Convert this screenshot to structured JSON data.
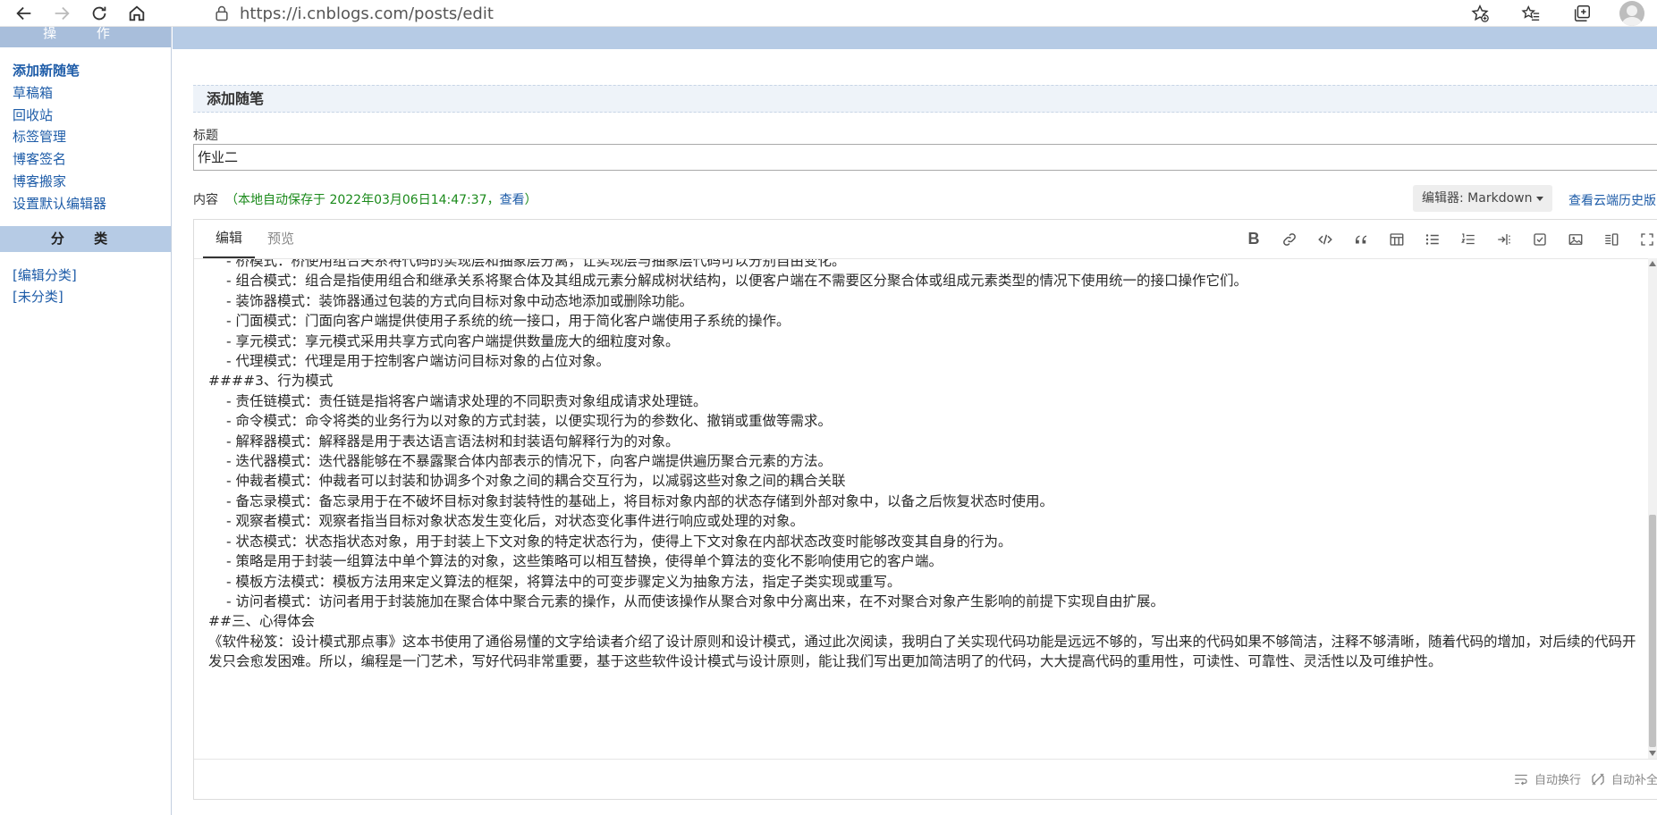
{
  "browser": {
    "url": "https://i.cnblogs.com/posts/edit"
  },
  "sidebar": {
    "header": "操 作",
    "links": [
      {
        "label": "添加新随笔"
      },
      {
        "label": "草稿箱"
      },
      {
        "label": "回收站"
      },
      {
        "label": "标签管理"
      },
      {
        "label": "博客签名"
      },
      {
        "label": "博客搬家"
      },
      {
        "label": "设置默认编辑器"
      }
    ],
    "category_header": "分 类",
    "category_links": [
      {
        "label": "[编辑分类]"
      },
      {
        "label": "[未分类]"
      }
    ]
  },
  "main": {
    "section_title": "添加随笔",
    "title_label": "标题",
    "title_value": "作业二",
    "content_label": "内容",
    "autosave_note": "（本地自动保存于 2022年03月06日14:47:37，",
    "autosave_view": "查看",
    "autosave_close": "）",
    "editor_select": "编辑器: Markdown",
    "cloud_history": "查看云端历史版"
  },
  "editor": {
    "tabs": [
      {
        "label": "编辑"
      },
      {
        "label": "预览"
      }
    ],
    "toolbar_icons": [
      "bold-icon",
      "link-icon",
      "code-icon",
      "quote-icon",
      "table-icon",
      "unordered-list-icon",
      "ordered-list-icon",
      "indent-icon",
      "task-icon",
      "image-icon",
      "split-view-icon",
      "fullscreen-icon"
    ],
    "lines": [
      "-  桥模式：桥使用组合关系将代码的实现层和抽象层分离，让实现层与抽象层代码可以分别自由变化。",
      "-  组合模式：组合是指使用组合和继承关系将聚合体及其组成元素分解成树状结构，以便客户端在不需要区分聚合体或组成元素类型的情况下使用统一的接口操作它们。",
      "-  装饰器模式：装饰器通过包装的方式向目标对象中动态地添加或删除功能。",
      "-  门面模式：门面向客户端提供使用子系统的统一接口，用于简化客户端使用子系统的操作。",
      "-  享元模式：享元模式采用共享方式向客户端提供数量庞大的细粒度对象。",
      "-  代理模式：代理是用于控制客户端访问目标对象的占位对象。",
      "####3、行为模式",
      "-  责任链模式：责任链是指将客户端请求处理的不同职责对象组成请求处理链。",
      "-  命令模式：命令将类的业务行为以对象的方式封装，以便实现行为的参数化、撤销或重做等需求。",
      "-  解释器模式：解释器是用于表达语言语法树和封装语句解释行为的对象。",
      "-  迭代器模式：迭代器能够在不暴露聚合体内部表示的情况下，向客户端提供遍历聚合元素的方法。",
      "-  仲裁者模式：仲裁者可以封装和协调多个对象之间的耦合交互行为，以减弱这些对象之间的耦合关联",
      "-  备忘录模式：备忘录用于在不破坏目标对象封装特性的基础上，将目标对象内部的状态存储到外部对象中，以备之后恢复状态时使用。",
      "-  观察者模式：观察者指当目标对象状态发生变化后，对状态变化事件进行响应或处理的对象。",
      "-  状态模式：状态指状态对象，用于封装上下文对象的特定状态行为，使得上下文对象在内部状态改变时能够改变其自身的行为。",
      "-  策略是用于封装一组算法中单个算法的对象，这些策略可以相互替换，使得单个算法的变化不影响使用它的客户端。",
      "-  模板方法模式：模板方法用来定义算法的框架，将算法中的可变步骤定义为抽象方法，指定子类实现或重写。",
      "-  访问者模式：访问者用于封装施加在聚合体中聚合元素的操作，从而使该操作从聚合对象中分离出来，在不对聚合对象产生影响的前提下实现自由扩展。",
      "##三、心得体会"
    ],
    "paragraph": "《软件秘笈：设计模式那点事》这本书使用了通俗易懂的文字给读者介绍了设计原则和设计模式，通过此次阅读，我明白了关实现代码功能是远远不够的，写出来的代码如果不够简洁，注释不够清晰，随着代码的增加，对后续的代码开发只会愈发困难。所以，编程是一门艺术，写好代码非常重要，基于这些软件设计模式与设计原则，能让我们写出更加简洁明了的代码，大大提高代码的重用性，可读性、可靠性、灵活性以及可维护性。",
    "footer": {
      "auto_wrap": "自动换行",
      "auto_complete": "自动补全"
    }
  },
  "colors": {
    "header_blue": "#b6cbe5",
    "link_blue": "#1e5ca8",
    "autosave_green": "#1a8a1a"
  }
}
